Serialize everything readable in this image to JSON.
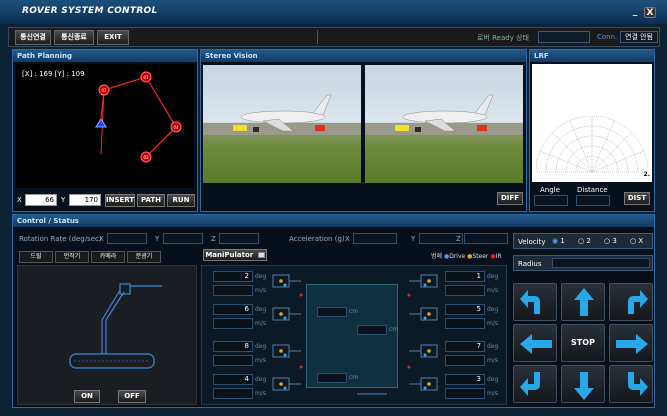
{
  "window": {
    "title": "ROVER SYSTEM CONTROL",
    "minimize": "_",
    "close": "X"
  },
  "toolbar": {
    "btn_connect": "통신연결",
    "btn_disconnect": "통신종료",
    "btn_exit": "EXIT",
    "ready_label": "로버 Ready 상태",
    "conn_label": "Conn.",
    "conn_value": "연결 안됨"
  },
  "path_planning": {
    "title": "Path Planning",
    "coords": "[X] : 169 [Y] : 109",
    "waypoints": [
      {
        "label": "01",
        "type": "node"
      },
      {
        "label": "02",
        "type": "node"
      },
      {
        "label": "03",
        "type": "node"
      },
      {
        "label": "04",
        "type": "node"
      }
    ],
    "x_label": "X",
    "x_value": "66",
    "y_label": "Y",
    "y_value": "170",
    "btn_insert": "INSERT",
    "btn_path": "PATH",
    "btn_run": "RUN"
  },
  "stereo": {
    "title": "Stereo Vision",
    "btn_diff": "DIFF"
  },
  "lrf": {
    "title": "LRF",
    "angle_label": "Angle",
    "distance_label": "Distance",
    "btn_dist": "DIST",
    "scale_label": "2."
  },
  "control": {
    "title": "Control / Status",
    "rotation_label": "Rotation Rate (deg/sec)",
    "accel_label": "Acceleration (g)",
    "axis_x": "X",
    "axis_y": "Y",
    "axis_z": "Z",
    "tabs": [
      "드릴",
      "먼작기",
      "카메라",
      "분광기"
    ],
    "manipulator_label": "ManiPulator",
    "btn_on": "ON",
    "btn_off": "OFF",
    "legend_prefix": "범례",
    "legend_drive": "Drive",
    "legend_steer": "Steer",
    "legend_ir": "IR",
    "legend_colors": {
      "drive": "#3ea0ff",
      "steer": "#f0a020",
      "ir": "#e02020"
    },
    "wheels_left": [
      {
        "id": "2",
        "unit_deg": "deg",
        "unit_ms": "m/s"
      },
      {
        "id": "6",
        "unit_deg": "deg",
        "unit_ms": "m/s"
      },
      {
        "id": "8",
        "unit_deg": "deg",
        "unit_ms": "m/s"
      },
      {
        "id": "4",
        "unit_deg": "deg",
        "unit_ms": "m/s"
      }
    ],
    "wheels_right": [
      {
        "id": "1",
        "unit_deg": "deg",
        "unit_ms": "m/s"
      },
      {
        "id": "5",
        "unit_deg": "deg",
        "unit_ms": "m/s"
      },
      {
        "id": "7",
        "unit_deg": "deg",
        "unit_ms": "m/s"
      },
      {
        "id": "3",
        "unit_deg": "deg",
        "unit_ms": "m/s"
      }
    ],
    "cm_label": "cm",
    "velocity_label": "Velocity",
    "velocity_options": [
      "1",
      "2",
      "3",
      "X"
    ],
    "velocity_selected": "1",
    "radius_label": "Radius",
    "btn_stop": "STOP"
  }
}
